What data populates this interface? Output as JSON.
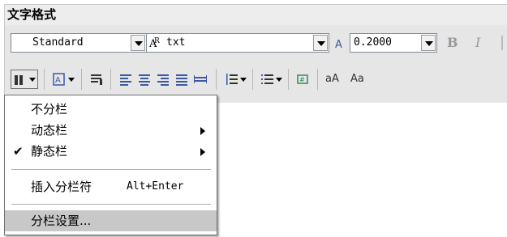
{
  "panel": {
    "title": "文字格式"
  },
  "format_bar": {
    "style_value": "Standard",
    "font_icon": "truetype-font-icon",
    "font_value": "txt",
    "height_value": "0.2000",
    "bold_label": "B",
    "italic_label": "I"
  },
  "toolbar": {
    "columns_icon": "columns-icon",
    "mtext_just_icon": "text-justification-icon",
    "paragraph_icon": "paragraph-icon",
    "align_left_icon": "align-left-icon",
    "align_center_icon": "align-center-icon",
    "align_right_icon": "align-right-icon",
    "justify_icon": "justify-icon",
    "distribute_icon": "distribute-icon",
    "line_spacing_icon": "line-spacing-icon",
    "numbering_icon": "numbering-icon",
    "insert_field_icon": "insert-field-icon",
    "uppercase_label": "aA",
    "lowercase_label": "Aa"
  },
  "columns_menu": {
    "items": [
      {
        "label": "不分栏",
        "submenu": false,
        "checked": false
      },
      {
        "label": "动态栏",
        "submenu": true,
        "checked": false
      },
      {
        "label": "静态栏",
        "submenu": true,
        "checked": true
      },
      {
        "label": "插入分栏符",
        "shortcut": "Alt+Enter"
      },
      {
        "label": "分栏设置..."
      }
    ],
    "check_mark": "✔"
  }
}
